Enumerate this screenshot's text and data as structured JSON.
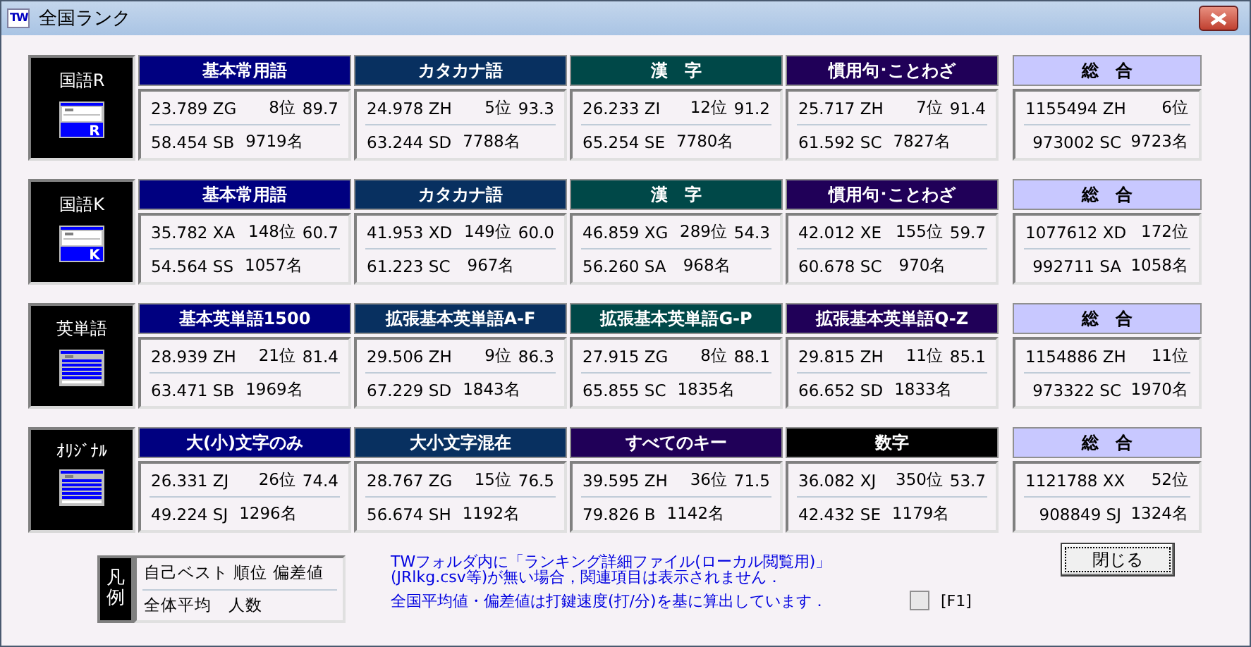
{
  "window": {
    "app_badge": "TW",
    "title": "全国ランク"
  },
  "groups": [
    {
      "label": "国語R",
      "icon": {
        "kind": "letter",
        "letter": "R"
      },
      "categories": [
        {
          "title": "基本常用語",
          "color": "#000080",
          "best": "23.789 ZG",
          "rank": "8位",
          "deviation": "89.7",
          "average": "58.454 SB",
          "count": "9719名"
        },
        {
          "title": "カタカナ語",
          "color": "#083060",
          "best": "24.978 ZH",
          "rank": "5位",
          "deviation": "93.3",
          "average": "63.244 SD",
          "count": "7788名"
        },
        {
          "title": "漢　字",
          "color": "#004848",
          "best": "26.233 ZI",
          "rank": "12位",
          "deviation": "91.2",
          "average": "65.254 SE",
          "count": "7780名"
        },
        {
          "title": "慣用句･ことわざ",
          "color": "#200058",
          "best": "25.717 ZH",
          "rank": "7位",
          "deviation": "91.4",
          "average": "61.592 SC",
          "count": "7827名"
        }
      ],
      "total": {
        "title": "総　合",
        "best": "1155494 ZH",
        "rank": "6位",
        "average": "973002 SC",
        "count": "9723名"
      }
    },
    {
      "label": "国語K",
      "icon": {
        "kind": "letter",
        "letter": "K"
      },
      "categories": [
        {
          "title": "基本常用語",
          "color": "#000080",
          "best": "35.782 XA",
          "rank": "148位",
          "deviation": "60.7",
          "average": "54.564 SS",
          "count": "1057名"
        },
        {
          "title": "カタカナ語",
          "color": "#083060",
          "best": "41.953 XD",
          "rank": "149位",
          "deviation": "60.0",
          "average": "61.223 SC",
          "count": "967名"
        },
        {
          "title": "漢　字",
          "color": "#004848",
          "best": "46.859 XG",
          "rank": "289位",
          "deviation": "54.3",
          "average": "56.260 SA",
          "count": "968名"
        },
        {
          "title": "慣用句･ことわざ",
          "color": "#200058",
          "best": "42.012 XE",
          "rank": "155位",
          "deviation": "59.7",
          "average": "60.678 SC",
          "count": "970名"
        }
      ],
      "total": {
        "title": "総　合",
        "best": "1077612 XD",
        "rank": "172位",
        "average": "992711 SA",
        "count": "1058名"
      }
    },
    {
      "label": "英単語",
      "icon": {
        "kind": "list"
      },
      "categories": [
        {
          "title": "基本英単語1500",
          "color": "#000080",
          "best": "28.939 ZH",
          "rank": "21位",
          "deviation": "81.4",
          "average": "63.471 SB",
          "count": "1969名"
        },
        {
          "title": "拡張基本英単語A-F",
          "color": "#083060",
          "best": "29.506 ZH",
          "rank": "9位",
          "deviation": "86.3",
          "average": "67.229 SD",
          "count": "1843名"
        },
        {
          "title": "拡張基本英単語G-P",
          "color": "#004848",
          "best": "27.915 ZG",
          "rank": "8位",
          "deviation": "88.1",
          "average": "65.855 SC",
          "count": "1835名"
        },
        {
          "title": "拡張基本英単語Q-Z",
          "color": "#200058",
          "best": "29.815 ZH",
          "rank": "11位",
          "deviation": "85.1",
          "average": "66.652 SD",
          "count": "1833名"
        }
      ],
      "total": {
        "title": "総　合",
        "best": "1154886 ZH",
        "rank": "11位",
        "average": "973322 SC",
        "count": "1970名"
      }
    },
    {
      "label": "ｵﾘｼﾞﾅﾙ",
      "icon": {
        "kind": "list"
      },
      "categories": [
        {
          "title": "大(小)文字のみ",
          "color": "#000080",
          "best": "26.331 ZJ",
          "rank": "26位",
          "deviation": "74.4",
          "average": "49.224 SJ",
          "count": "1296名"
        },
        {
          "title": "大小文字混在",
          "color": "#083060",
          "best": "28.767 ZG",
          "rank": "15位",
          "deviation": "76.5",
          "average": "56.674 SH",
          "count": "1192名"
        },
        {
          "title": "すべてのキー",
          "color": "#200058",
          "best": "39.595 ZH",
          "rank": "36位",
          "deviation": "71.5",
          "average": "79.826 B",
          "count": "1142名"
        },
        {
          "title": "数字",
          "color": "#000000",
          "best": "36.082 XJ",
          "rank": "350位",
          "deviation": "53.7",
          "average": "42.432 SE",
          "count": "1179名"
        }
      ],
      "total": {
        "title": "総　合",
        "best": "1121788 XX",
        "rank": "52位",
        "average": "908849 SJ",
        "count": "1324名"
      }
    }
  ],
  "legend": {
    "title": "凡例",
    "line_1": "自己ベスト 順位 偏差値",
    "line_2": "全体平均　人数"
  },
  "notes": [
    "TWフォルダ内に「ランキング詳細ファイル(ローカル閲覧用)」(JRlkg.csv等)が無い場合，関連項目は表示されません．",
    "全国平均値・偏差値は打鍵速度(打/分)を基に算出しています．"
  ],
  "help_checkbox": {
    "label": "[F1]",
    "checked": false
  },
  "close_button": "閉じる"
}
